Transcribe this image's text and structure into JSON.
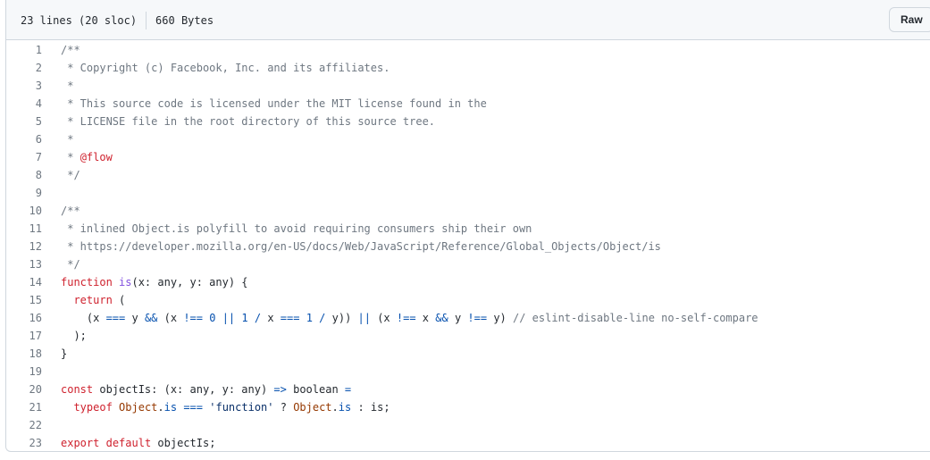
{
  "file_info": {
    "lines": "23 lines (20 sloc)",
    "size": "660 Bytes"
  },
  "toolbar": {
    "raw_label": "Raw"
  },
  "code_lines": [
    {
      "n": "1",
      "tokens": [
        [
          "c",
          "/**"
        ]
      ]
    },
    {
      "n": "2",
      "tokens": [
        [
          "c",
          " * Copyright (c) Facebook, Inc. and its affiliates."
        ]
      ]
    },
    {
      "n": "3",
      "tokens": [
        [
          "c",
          " *"
        ]
      ]
    },
    {
      "n": "4",
      "tokens": [
        [
          "c",
          " * This source code is licensed under the MIT license found in the"
        ]
      ]
    },
    {
      "n": "5",
      "tokens": [
        [
          "c",
          " * LICENSE file in the root directory of this source tree."
        ]
      ]
    },
    {
      "n": "6",
      "tokens": [
        [
          "c",
          " *"
        ]
      ]
    },
    {
      "n": "7",
      "tokens": [
        [
          "c",
          " * "
        ],
        [
          "k",
          "@flow"
        ]
      ]
    },
    {
      "n": "8",
      "tokens": [
        [
          "c",
          " */"
        ]
      ]
    },
    {
      "n": "9",
      "tokens": []
    },
    {
      "n": "10",
      "tokens": [
        [
          "c",
          "/**"
        ]
      ]
    },
    {
      "n": "11",
      "tokens": [
        [
          "c",
          " * inlined Object.is polyfill to avoid requiring consumers ship their own"
        ]
      ]
    },
    {
      "n": "12",
      "tokens": [
        [
          "c",
          " * https://developer.mozilla.org/en-US/docs/Web/JavaScript/Reference/Global_Objects/Object/is"
        ]
      ]
    },
    {
      "n": "13",
      "tokens": [
        [
          "c",
          " */"
        ]
      ]
    },
    {
      "n": "14",
      "tokens": [
        [
          "k",
          "function"
        ],
        [
          "t",
          " "
        ],
        [
          "f",
          "is"
        ],
        [
          "t",
          "(x: any, y: any) {"
        ]
      ]
    },
    {
      "n": "15",
      "tokens": [
        [
          "t",
          "  "
        ],
        [
          "k",
          "return"
        ],
        [
          "t",
          " ("
        ]
      ]
    },
    {
      "n": "16",
      "tokens": [
        [
          "t",
          "    (x "
        ],
        [
          "o",
          "==="
        ],
        [
          "t",
          " y "
        ],
        [
          "o",
          "&&"
        ],
        [
          "t",
          " (x "
        ],
        [
          "o",
          "!=="
        ],
        [
          "t",
          " "
        ],
        [
          "a",
          "0"
        ],
        [
          "t",
          " "
        ],
        [
          "o",
          "||"
        ],
        [
          "t",
          " "
        ],
        [
          "a",
          "1"
        ],
        [
          "t",
          " "
        ],
        [
          "o",
          "/"
        ],
        [
          "t",
          " x "
        ],
        [
          "o",
          "==="
        ],
        [
          "t",
          " "
        ],
        [
          "a",
          "1"
        ],
        [
          "t",
          " "
        ],
        [
          "o",
          "/"
        ],
        [
          "t",
          " y)) "
        ],
        [
          "o",
          "||"
        ],
        [
          "t",
          " (x "
        ],
        [
          "o",
          "!=="
        ],
        [
          "t",
          " x "
        ],
        [
          "o",
          "&&"
        ],
        [
          "t",
          " y "
        ],
        [
          "o",
          "!=="
        ],
        [
          "t",
          " y) "
        ],
        [
          "c",
          "// eslint-disable-line no-self-compare"
        ]
      ]
    },
    {
      "n": "17",
      "tokens": [
        [
          "t",
          "  );"
        ]
      ]
    },
    {
      "n": "18",
      "tokens": [
        [
          "t",
          "}"
        ]
      ]
    },
    {
      "n": "19",
      "tokens": []
    },
    {
      "n": "20",
      "tokens": [
        [
          "k",
          "const"
        ],
        [
          "t",
          " objectIs: (x: any, y: any) "
        ],
        [
          "o",
          "=>"
        ],
        [
          "t",
          " boolean "
        ],
        [
          "o",
          "="
        ]
      ]
    },
    {
      "n": "21",
      "tokens": [
        [
          "t",
          "  "
        ],
        [
          "k",
          "typeof"
        ],
        [
          "t",
          " "
        ],
        [
          "n",
          "Object"
        ],
        [
          "t",
          "."
        ],
        [
          "a",
          "is"
        ],
        [
          "t",
          " "
        ],
        [
          "o",
          "==="
        ],
        [
          "t",
          " "
        ],
        [
          "s",
          "'function'"
        ],
        [
          "t",
          " ? "
        ],
        [
          "n",
          "Object"
        ],
        [
          "t",
          "."
        ],
        [
          "a",
          "is"
        ],
        [
          "t",
          " : is;"
        ]
      ]
    },
    {
      "n": "22",
      "tokens": []
    },
    {
      "n": "23",
      "tokens": [
        [
          "k",
          "export"
        ],
        [
          "t",
          " "
        ],
        [
          "k",
          "default"
        ],
        [
          "t",
          " objectIs;"
        ]
      ]
    }
  ]
}
